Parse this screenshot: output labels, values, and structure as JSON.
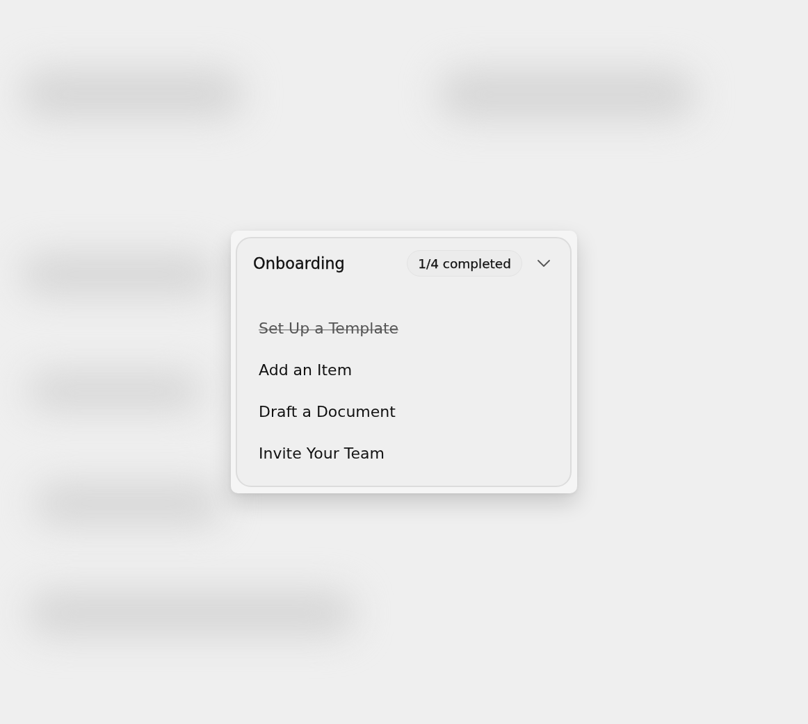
{
  "card": {
    "title": "Onboarding",
    "progress_badge": "1/4 completed",
    "expanded": true,
    "tasks": [
      {
        "label": "Set Up a Template",
        "completed": true
      },
      {
        "label": "Add an Item",
        "completed": false
      },
      {
        "label": "Draft a Document",
        "completed": false
      },
      {
        "label": "Invite Your Team",
        "completed": false
      }
    ]
  }
}
